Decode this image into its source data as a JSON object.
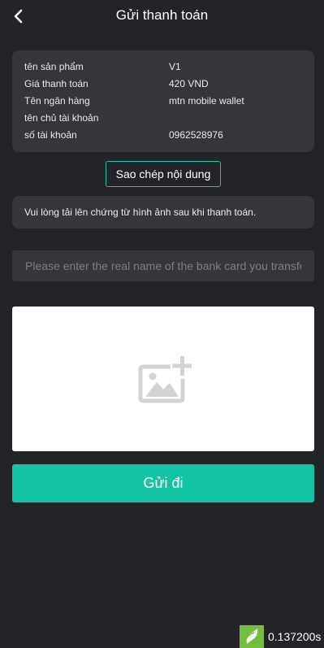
{
  "header": {
    "title": "Gửi thanh toán",
    "back_icon": "chevron-left-icon"
  },
  "info": {
    "rows": [
      {
        "label": "tên sản phẩm",
        "value": "V1"
      },
      {
        "label": "Giá thanh toán",
        "value": "420 VND"
      },
      {
        "label": "Tên ngân hàng",
        "value": "mtn mobile wallet"
      },
      {
        "label": "tên chủ tài khoản",
        "value": ""
      },
      {
        "label": "số tài khoản",
        "value": "0962528976"
      }
    ]
  },
  "copy_button": {
    "label": "Sao chép nội dung"
  },
  "notice": {
    "text": "Vui lòng tải lên chứng từ hình ảnh sau khi thanh toán."
  },
  "name_input": {
    "placeholder": "Please enter the real name of the bank card you transfer",
    "value": ""
  },
  "upload": {
    "icon": "add-image-icon"
  },
  "submit_button": {
    "label": "Gửi đi"
  },
  "timer": {
    "text": "0.137200s",
    "icon": "leaf-logo-icon"
  },
  "colors": {
    "background": "#232428",
    "card": "#35363a",
    "accent": "#12c4a4",
    "timer_logo": "#76bc3e"
  }
}
